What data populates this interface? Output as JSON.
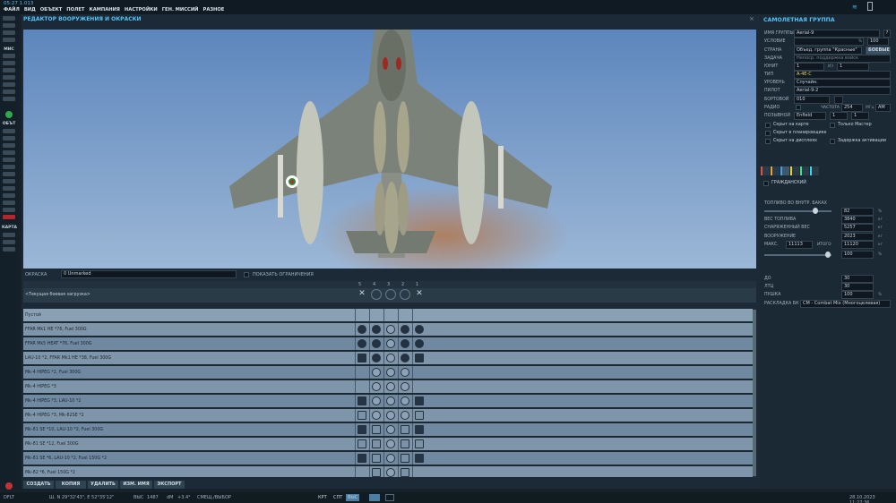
{
  "topbar": {
    "time": "05:27 1.013",
    "menu": [
      "ФАЙЛ",
      "ВИД",
      "ОБЪЕКТ",
      "ПОЛЕТ",
      "КАМПАНИЯ",
      "НАСТРОЙКИ",
      "ГЕН. МИССИЙ",
      "РАЗНОЕ"
    ]
  },
  "left_toolbar": {
    "mis_label": "МИС",
    "obj_label": "ОБЪТ",
    "map_label": "КАРТА"
  },
  "editor": {
    "title": "РЕДАКТОР ВООРУЖЕНИЯ И ОКРАСКИ",
    "paint_label": "ОКРАСКА",
    "paint_value": "0 Unmarked",
    "show_limits_label": "ПОКАЗАТЬ ОГРАНИЧЕНИЯ",
    "stations": [
      "5",
      "4",
      "3",
      "2",
      "1"
    ],
    "current_loadout": "<Текущая боевая загрузка>",
    "loadouts": [
      {
        "name": "Пустой",
        "icons": [
          "",
          "",
          "",
          "",
          ""
        ]
      },
      {
        "name": "FFAR Mk1 HE *76, Fuel 300G",
        "icons": [
          "b",
          "b",
          "h",
          "b",
          "b"
        ]
      },
      {
        "name": "FFAR Mk5 HEAT *76, Fuel 300G",
        "icons": [
          "b",
          "b",
          "h",
          "b",
          "b"
        ]
      },
      {
        "name": "LAU-10 *2, FFAR Mk1 HE *38, Fuel 300G",
        "icons": [
          "g",
          "b",
          "h",
          "b",
          "g"
        ]
      },
      {
        "name": "Mk-4 HIPEG *2, Fuel 300G",
        "icons": [
          "",
          "h",
          "h",
          "h",
          ""
        ]
      },
      {
        "name": "Mk-4 HIPEG *3",
        "icons": [
          "",
          "h",
          "h",
          "h",
          ""
        ]
      },
      {
        "name": "Mk-4 HIPEG *3, LAU-10 *2",
        "icons": [
          "g",
          "h",
          "h",
          "h",
          "g"
        ]
      },
      {
        "name": "Mk-4 HIPEG *3, Mk-82SE *2",
        "icons": [
          "s",
          "h",
          "h",
          "h",
          "s"
        ]
      },
      {
        "name": "Mk-81 SE *10, LAU-10 *2, Fuel 300G",
        "icons": [
          "g",
          "s",
          "h",
          "s",
          "g"
        ]
      },
      {
        "name": "Mk-81 SE *12, Fuel 300G",
        "icons": [
          "s",
          "s",
          "h",
          "s",
          "s"
        ]
      },
      {
        "name": "Mk-81 SE *6, LAU-10 *2, Fuel 150G *2",
        "icons": [
          "g",
          "s",
          "h",
          "s",
          "g"
        ]
      },
      {
        "name": "Mk-82 *6, Fuel 150G *2",
        "icons": [
          "",
          "s",
          "h",
          "s",
          ""
        ]
      }
    ],
    "buttons": [
      "СОЗДАТЬ",
      "КОПИЯ",
      "УДАЛИТЬ",
      "ИЗМ. ИМЯ",
      "ЭКСПОРТ"
    ]
  },
  "group": {
    "title": "САМОЛЕТНАЯ ГРУППА",
    "name_label": "ИМЯ ГРУППЫ",
    "name_value": "Aerial-9",
    "condition_label": "УСЛОВИЕ",
    "condition_pct": "100",
    "country_label": "СТРАНА",
    "country_value": "Объед. группа \"Красные\"",
    "combat_label": "БОЕВЫЕ",
    "task_label": "ЗАДАЧА",
    "task_value": "Непоср. поддержка войск",
    "unit_label": "ЮНИТ",
    "unit_value": "1",
    "unit_of_label": "ИЗ",
    "unit_of_value": "1",
    "type_label": "ТИП",
    "type_value": "A-4E-C",
    "level_label": "УРОВЕНЬ",
    "level_value": "Случайн.",
    "pilot_label": "ПИЛОТ",
    "pilot_value": "Aerial-9-2",
    "board_label": "БОРТОВОЙ",
    "board_value": "010",
    "radio_label": "РАДИО",
    "freq_label": "ЧАСТОТА",
    "freq_value": "254",
    "freq_unit": "МГц",
    "am_label": "AM",
    "callsign_label": "ПОЗЫВНОЙ",
    "callsign_value": "Enfield",
    "callsign_num1": "1",
    "callsign_num2": "1",
    "hide_map": "Скрыт на карте",
    "master_only": "Только Мастер",
    "hide_planner": "Скрыт в планировщике",
    "hide_display": "Скрыт на дисплеях",
    "activation_delay": "Задержка активации",
    "civil": "ГРАЖДАНСКИЙ",
    "fuel_label": "ТОПЛИВО ВО ВНУТР. БАКАХ",
    "fuel_pct": "82",
    "fuel_weight_label": "ВЕС ТОПЛИВА",
    "fuel_weight": "3840",
    "empty_weight_label": "СНАРЯЖЕННЫЙ ВЕС",
    "empty_weight": "5257",
    "weapons_label": "ВООРУЖЕНИЕ",
    "weapons_weight": "2023",
    "max_label": "МАКС.",
    "max_value": "11113",
    "total_label": "ИТОГО",
    "total_value": "11120",
    "load_pct": "100",
    "do_label": "ДО",
    "do_value": "30",
    "ltc_label": "ЛТЦ",
    "ltc_value": "30",
    "gun_label": "ПУШКА",
    "gun_value": "100",
    "ammo_label": "РАСКЛАДКА БК",
    "ammo_value": "CM - Combat Mix (Многоцелевая)",
    "unit_kg": "кг",
    "unit_pct": "%"
  },
  "status": {
    "mode": "DFLT",
    "coords": "Ш. N 29°32'43\", E 52°35'12\"",
    "alt_label": "ВЫС",
    "alt_value": "1487",
    "dm_label": "dM",
    "dm_value": "+3.4°",
    "action": "СМЕЩ./ВЫБОР",
    "btn_krt": "КРТ",
    "btn_spt": "СПТ",
    "btn_vys": "ВЫС",
    "datetime": "28.10.2023 11:27:36"
  }
}
